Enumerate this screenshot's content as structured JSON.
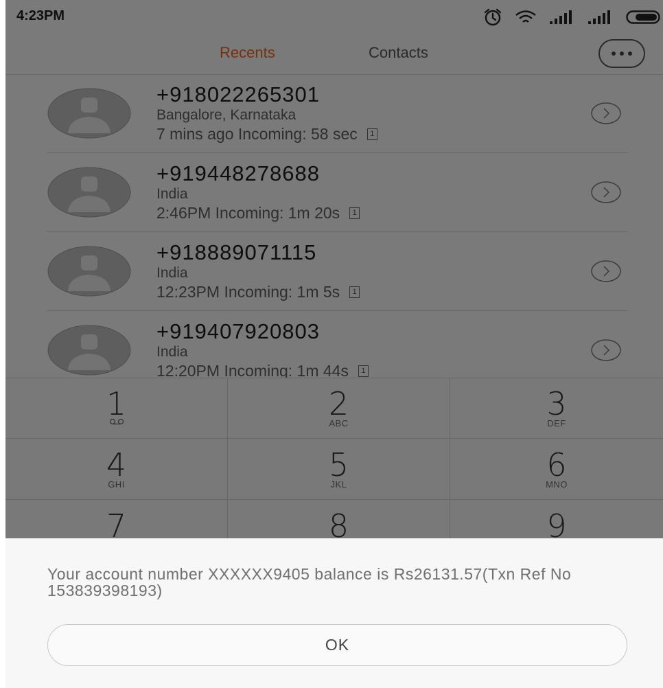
{
  "status_bar": {
    "time": "4:23PM",
    "icons": [
      "alarm-icon",
      "wifi-icon",
      "signal-icon",
      "signal-icon",
      "battery-icon"
    ]
  },
  "tabs": {
    "recents": "Recents",
    "contacts": "Contacts",
    "active": "recents",
    "active_color": "#e5631f",
    "more_icon": "more-dots-icon"
  },
  "calls": [
    {
      "number": "+918022265301",
      "location": "Bangalore, Karnataka",
      "detail": "7 mins ago Incoming: 58 sec",
      "sim": "1"
    },
    {
      "number": "+919448278688",
      "location": "India",
      "detail": "2:46PM Incoming: 1m 20s",
      "sim": "1"
    },
    {
      "number": "+918889071115",
      "location": "India",
      "detail": "12:23PM Incoming: 1m 5s",
      "sim": "1"
    },
    {
      "number": "+919407920803",
      "location": "India",
      "detail": "12:20PM Incoming: 1m 44s",
      "sim": "1"
    }
  ],
  "dialpad": {
    "keys": [
      {
        "digit": "1",
        "letters": ""
      },
      {
        "digit": "2",
        "letters": "ABC"
      },
      {
        "digit": "3",
        "letters": "DEF"
      },
      {
        "digit": "4",
        "letters": "GHI"
      },
      {
        "digit": "5",
        "letters": "JKL"
      },
      {
        "digit": "6",
        "letters": "MNO"
      },
      {
        "digit": "7",
        "letters": ""
      },
      {
        "digit": "8",
        "letters": ""
      },
      {
        "digit": "9",
        "letters": ""
      }
    ]
  },
  "dialog": {
    "message": "Your account number XXXXXX9405 balance is Rs26131.57(Txn Ref No 153839398193)",
    "ok_label": "OK"
  }
}
